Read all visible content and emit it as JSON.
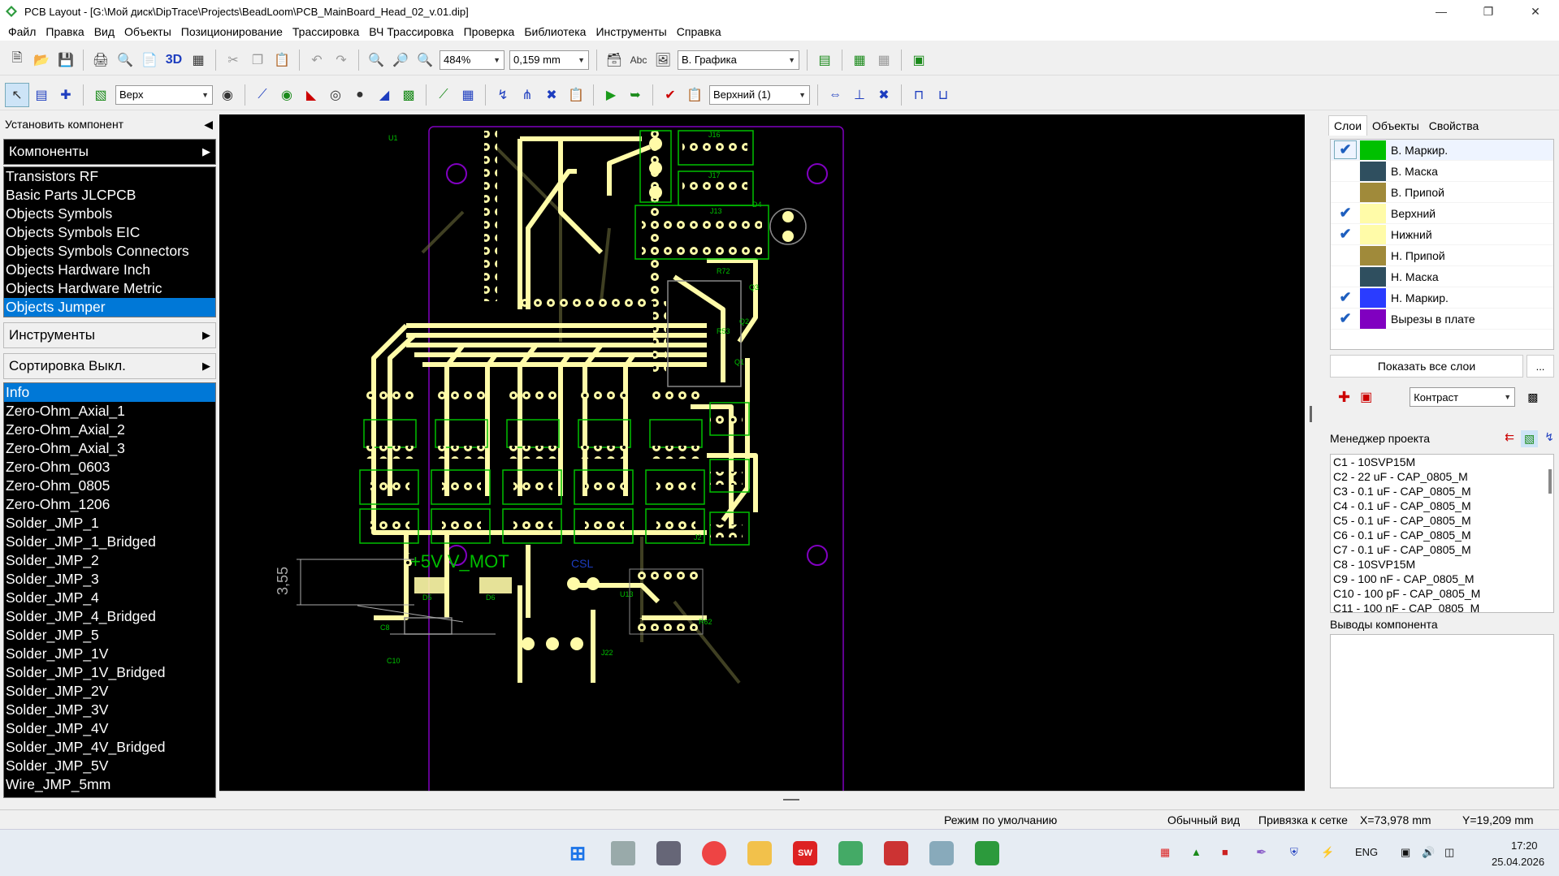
{
  "window": {
    "title": "PCB Layout - [G:\\Мой диск\\DipTrace\\Projects\\BeadLoom\\PCB_MainBoard_Head_02_v.01.dip]"
  },
  "menu": [
    "Файл",
    "Правка",
    "Вид",
    "Объекты",
    "Позиционирование",
    "Трассировка",
    "ВЧ Трассировка",
    "Проверка",
    "Библиотека",
    "Инструменты",
    "Справка"
  ],
  "toolbar": {
    "zoom": "484%",
    "grid": "0,159 mm",
    "mode": "В. Графика",
    "layer": "Верх",
    "layer_pair": "Верхний (1)",
    "text_tool": "Abc",
    "view3d": "3D"
  },
  "left": {
    "header": "Установить компонент",
    "components_label": "Компоненты",
    "libraries": [
      "Transistors RF",
      "Basic Parts JLCPCB",
      "Objects Symbols",
      "Objects Symbols EIC",
      "Objects Symbols Connectors",
      "Objects Hardware Inch",
      "Objects Hardware Metric",
      "Objects Jumper"
    ],
    "tools_label": "Инструменты",
    "sort_label": "Сортировка Выкл.",
    "items": [
      "Info",
      "Zero-Ohm_Axial_1",
      "Zero-Ohm_Axial_2",
      "Zero-Ohm_Axial_3",
      "Zero-Ohm_0603",
      "Zero-Ohm_0805",
      "Zero-Ohm_1206",
      "Solder_JMP_1",
      "Solder_JMP_1_Bridged",
      "Solder_JMP_2",
      "Solder_JMP_3",
      "Solder_JMP_4",
      "Solder_JMP_4_Bridged",
      "Solder_JMP_5",
      "Solder_JMP_1V",
      "Solder_JMP_1V_Bridged",
      "Solder_JMP_2V",
      "Solder_JMP_3V",
      "Solder_JMP_4V",
      "Solder_JMP_4V_Bridged",
      "Solder_JMP_5V",
      "Wire_JMP_5mm"
    ]
  },
  "right": {
    "tabs": [
      "Слои",
      "Объекты",
      "Свойства"
    ],
    "layers": [
      {
        "name": "В. Маркир.",
        "color": "#00c000",
        "checked": true
      },
      {
        "name": "В. Маска",
        "color": "#2f4f5f",
        "checked": false
      },
      {
        "name": "В. Припой",
        "color": "#a08a3a",
        "checked": false
      },
      {
        "name": "Верхний",
        "color": "#fffba8",
        "checked": true
      },
      {
        "name": "Нижний",
        "color": "#fffba8",
        "checked": true
      },
      {
        "name": "Н. Припой",
        "color": "#a08a3a",
        "checked": false
      },
      {
        "name": "Н. Маска",
        "color": "#2f4f5f",
        "checked": false
      },
      {
        "name": "Н. Маркир.",
        "color": "#2a3cff",
        "checked": true
      },
      {
        "name": "Вырезы в плате",
        "color": "#8000c0",
        "checked": true
      }
    ],
    "show_all": "Показать все слои",
    "more": "...",
    "contrast": "Контраст",
    "pm_title": "Менеджер проекта",
    "pm_items": [
      "C1 - 10SVP15M",
      "C2 - 22 uF - CAP_0805_M",
      "C3 - 0.1 uF - CAP_0805_M",
      "C4 - 0.1 uF - CAP_0805_M",
      "C5 - 0.1 uF - CAP_0805_M",
      "C6 - 0.1 uF - CAP_0805_M",
      "C7 - 0.1 uF - CAP_0805_M",
      "C8 - 10SVP15M",
      "C9 - 100 nF - CAP_0805_M",
      "C10 - 100 pF - CAP_0805_M",
      "C11 - 100 nF - CAP_0805_M"
    ],
    "pins_label": "Выводы компонента"
  },
  "pcb": {
    "labels": {
      "u1": "U1",
      "j16": "J16",
      "j17": "J17",
      "j13": "J13",
      "d4": "D4",
      "r72": "R72",
      "q3": "Q3",
      "q2": "Q2",
      "q1": "Q1",
      "r53": "R53",
      "j2": "J2",
      "u13": "U13",
      "r62": "R62",
      "d5": "D5",
      "d6": "D6",
      "c8": "C8",
      "c10": "C10",
      "j22": "J22",
      "vmot": "+5V  V_MOT",
      "csl": "CSL",
      "dim": "3,55"
    }
  },
  "status": {
    "mode": "Режим по умолчанию",
    "view": "Обычный вид",
    "snap": "Привязка к сетке",
    "x": "X=73,978 mm",
    "y": "Y=19,209 mm"
  },
  "tray": {
    "lang": "ENG",
    "time": "17:20",
    "date": "25.04.2026"
  }
}
